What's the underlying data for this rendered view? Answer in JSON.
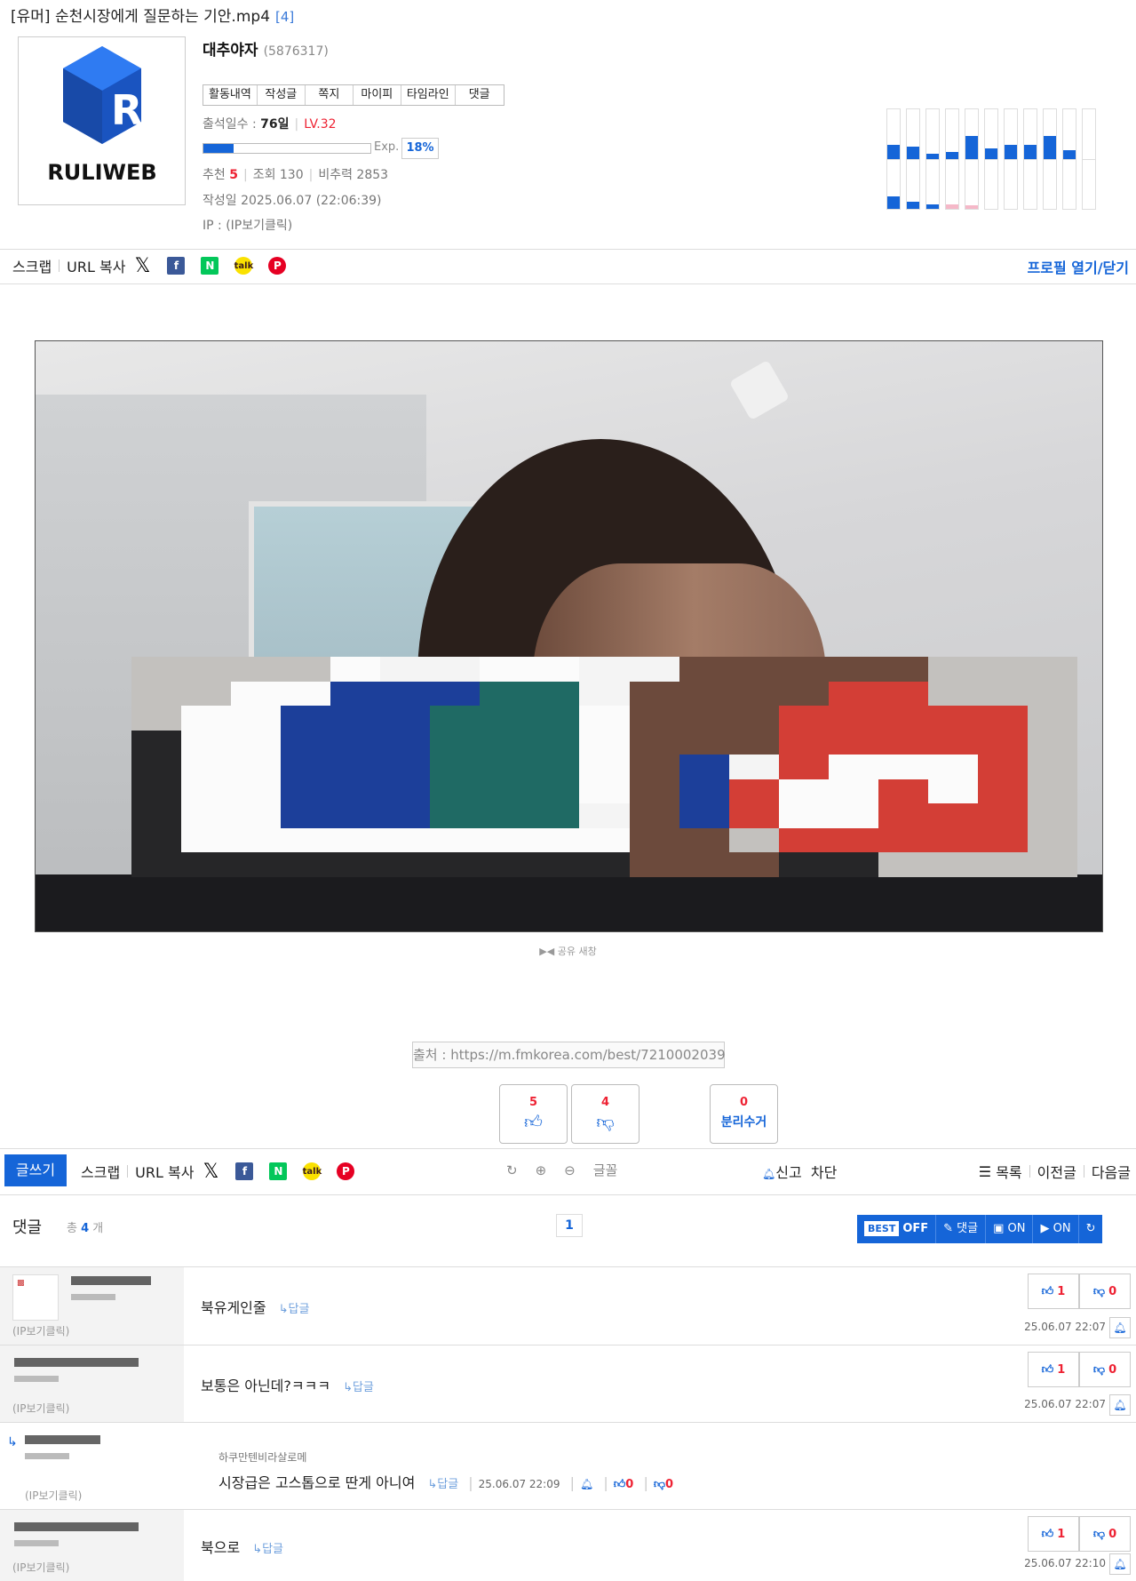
{
  "post": {
    "title": "[유머] 순천시장에게 질문하는 기안.mp4",
    "comment_count": "[4]"
  },
  "profile": {
    "logo_text": "RULIWEB",
    "nickname": "대추야자",
    "user_id": "(5876317)",
    "tabs": [
      "활동내역",
      "작성글",
      "쪽지",
      "마이피",
      "타임라인",
      "댓글"
    ],
    "attendance_label": "출석일수 :",
    "attendance_value": "76일",
    "level": "LV.32",
    "exp_label": "Exp.",
    "exp_pct": "18%",
    "exp_fraction": 0.18,
    "recommend_label": "추천",
    "recommend_value": "5",
    "views_label": "조회 130",
    "nonrec_label": "비추력 2853",
    "created": "작성일 2025.06.07 (22:06:39)",
    "ip": "IP : (IP보기클릭)",
    "toggle": "프로필 열기/닫기",
    "activity_colors": {
      "up": "#1565d8",
      "down": "#1565d8",
      "pink": "#f5b8c8"
    }
  },
  "share": {
    "scrap": "스크랩",
    "url_copy": "URL 복사",
    "x_icon": "𝕏",
    "fb_icon": "f",
    "naver_icon": "N",
    "kakao_icon": "talk",
    "pin_icon": "P"
  },
  "video": {
    "share_note": "▶◀ 공유 새창"
  },
  "source": "출처 : https://m.fmkorea.com/best/7210002039",
  "votes": {
    "up_count": "5",
    "down_count": "4",
    "recycle_count": "0",
    "recycle_label": "분리수거"
  },
  "toolbar": {
    "write": "글쓰기",
    "scrap": "스크랩",
    "url_copy": "URL 복사",
    "font": "글꼴",
    "report": "신고",
    "block": "차단",
    "list": "목록",
    "prev": "이전글",
    "next": "다음글"
  },
  "comments": {
    "title": "댓글",
    "count_prefix": "총",
    "count": "4",
    "count_suffix": "개",
    "page": "1",
    "best": "BEST",
    "best_state": "OFF",
    "reply_btn": "✎ 댓글",
    "image_btn": "▣ ON",
    "video_btn": "▶ ON",
    "refresh": "↻",
    "reply_label": "↳답글",
    "ip_label": "(IP보기클릭)",
    "items": [
      {
        "text": "북유게인줄",
        "up": "1",
        "down": "0",
        "date": "25.06.07 22:07"
      },
      {
        "text": "보통은 아닌데?ㅋㅋㅋ",
        "up": "1",
        "down": "0",
        "date": "25.06.07 22:07"
      },
      {
        "quote": "하쿠만텐비라살로메",
        "text": "시장급은 고스톱으로 딴게 아니여",
        "up": "0",
        "down": "0",
        "date": "25.06.07 22:09"
      },
      {
        "text": "북으로",
        "up": "1",
        "down": "0",
        "date": "25.06.07 22:10"
      }
    ]
  }
}
